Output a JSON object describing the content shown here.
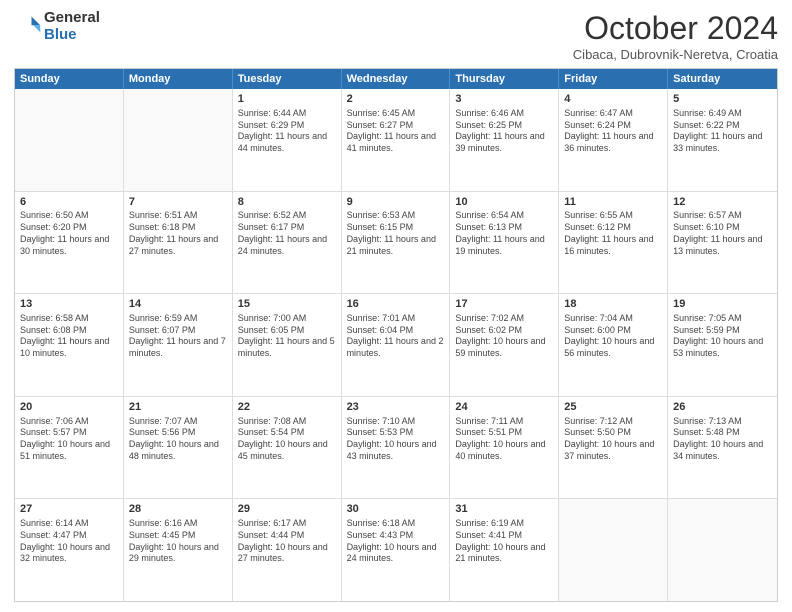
{
  "logo": {
    "general": "General",
    "blue": "Blue"
  },
  "title": "October 2024",
  "subtitle": "Cibaca, Dubrovnik-Neretva, Croatia",
  "header_days": [
    "Sunday",
    "Monday",
    "Tuesday",
    "Wednesday",
    "Thursday",
    "Friday",
    "Saturday"
  ],
  "weeks": [
    [
      {
        "day": "",
        "info": ""
      },
      {
        "day": "",
        "info": ""
      },
      {
        "day": "1",
        "info": "Sunrise: 6:44 AM\nSunset: 6:29 PM\nDaylight: 11 hours and 44 minutes."
      },
      {
        "day": "2",
        "info": "Sunrise: 6:45 AM\nSunset: 6:27 PM\nDaylight: 11 hours and 41 minutes."
      },
      {
        "day": "3",
        "info": "Sunrise: 6:46 AM\nSunset: 6:25 PM\nDaylight: 11 hours and 39 minutes."
      },
      {
        "day": "4",
        "info": "Sunrise: 6:47 AM\nSunset: 6:24 PM\nDaylight: 11 hours and 36 minutes."
      },
      {
        "day": "5",
        "info": "Sunrise: 6:49 AM\nSunset: 6:22 PM\nDaylight: 11 hours and 33 minutes."
      }
    ],
    [
      {
        "day": "6",
        "info": "Sunrise: 6:50 AM\nSunset: 6:20 PM\nDaylight: 11 hours and 30 minutes."
      },
      {
        "day": "7",
        "info": "Sunrise: 6:51 AM\nSunset: 6:18 PM\nDaylight: 11 hours and 27 minutes."
      },
      {
        "day": "8",
        "info": "Sunrise: 6:52 AM\nSunset: 6:17 PM\nDaylight: 11 hours and 24 minutes."
      },
      {
        "day": "9",
        "info": "Sunrise: 6:53 AM\nSunset: 6:15 PM\nDaylight: 11 hours and 21 minutes."
      },
      {
        "day": "10",
        "info": "Sunrise: 6:54 AM\nSunset: 6:13 PM\nDaylight: 11 hours and 19 minutes."
      },
      {
        "day": "11",
        "info": "Sunrise: 6:55 AM\nSunset: 6:12 PM\nDaylight: 11 hours and 16 minutes."
      },
      {
        "day": "12",
        "info": "Sunrise: 6:57 AM\nSunset: 6:10 PM\nDaylight: 11 hours and 13 minutes."
      }
    ],
    [
      {
        "day": "13",
        "info": "Sunrise: 6:58 AM\nSunset: 6:08 PM\nDaylight: 11 hours and 10 minutes."
      },
      {
        "day": "14",
        "info": "Sunrise: 6:59 AM\nSunset: 6:07 PM\nDaylight: 11 hours and 7 minutes."
      },
      {
        "day": "15",
        "info": "Sunrise: 7:00 AM\nSunset: 6:05 PM\nDaylight: 11 hours and 5 minutes."
      },
      {
        "day": "16",
        "info": "Sunrise: 7:01 AM\nSunset: 6:04 PM\nDaylight: 11 hours and 2 minutes."
      },
      {
        "day": "17",
        "info": "Sunrise: 7:02 AM\nSunset: 6:02 PM\nDaylight: 10 hours and 59 minutes."
      },
      {
        "day": "18",
        "info": "Sunrise: 7:04 AM\nSunset: 6:00 PM\nDaylight: 10 hours and 56 minutes."
      },
      {
        "day": "19",
        "info": "Sunrise: 7:05 AM\nSunset: 5:59 PM\nDaylight: 10 hours and 53 minutes."
      }
    ],
    [
      {
        "day": "20",
        "info": "Sunrise: 7:06 AM\nSunset: 5:57 PM\nDaylight: 10 hours and 51 minutes."
      },
      {
        "day": "21",
        "info": "Sunrise: 7:07 AM\nSunset: 5:56 PM\nDaylight: 10 hours and 48 minutes."
      },
      {
        "day": "22",
        "info": "Sunrise: 7:08 AM\nSunset: 5:54 PM\nDaylight: 10 hours and 45 minutes."
      },
      {
        "day": "23",
        "info": "Sunrise: 7:10 AM\nSunset: 5:53 PM\nDaylight: 10 hours and 43 minutes."
      },
      {
        "day": "24",
        "info": "Sunrise: 7:11 AM\nSunset: 5:51 PM\nDaylight: 10 hours and 40 minutes."
      },
      {
        "day": "25",
        "info": "Sunrise: 7:12 AM\nSunset: 5:50 PM\nDaylight: 10 hours and 37 minutes."
      },
      {
        "day": "26",
        "info": "Sunrise: 7:13 AM\nSunset: 5:48 PM\nDaylight: 10 hours and 34 minutes."
      }
    ],
    [
      {
        "day": "27",
        "info": "Sunrise: 6:14 AM\nSunset: 4:47 PM\nDaylight: 10 hours and 32 minutes."
      },
      {
        "day": "28",
        "info": "Sunrise: 6:16 AM\nSunset: 4:45 PM\nDaylight: 10 hours and 29 minutes."
      },
      {
        "day": "29",
        "info": "Sunrise: 6:17 AM\nSunset: 4:44 PM\nDaylight: 10 hours and 27 minutes."
      },
      {
        "day": "30",
        "info": "Sunrise: 6:18 AM\nSunset: 4:43 PM\nDaylight: 10 hours and 24 minutes."
      },
      {
        "day": "31",
        "info": "Sunrise: 6:19 AM\nSunset: 4:41 PM\nDaylight: 10 hours and 21 minutes."
      },
      {
        "day": "",
        "info": ""
      },
      {
        "day": "",
        "info": ""
      }
    ]
  ]
}
